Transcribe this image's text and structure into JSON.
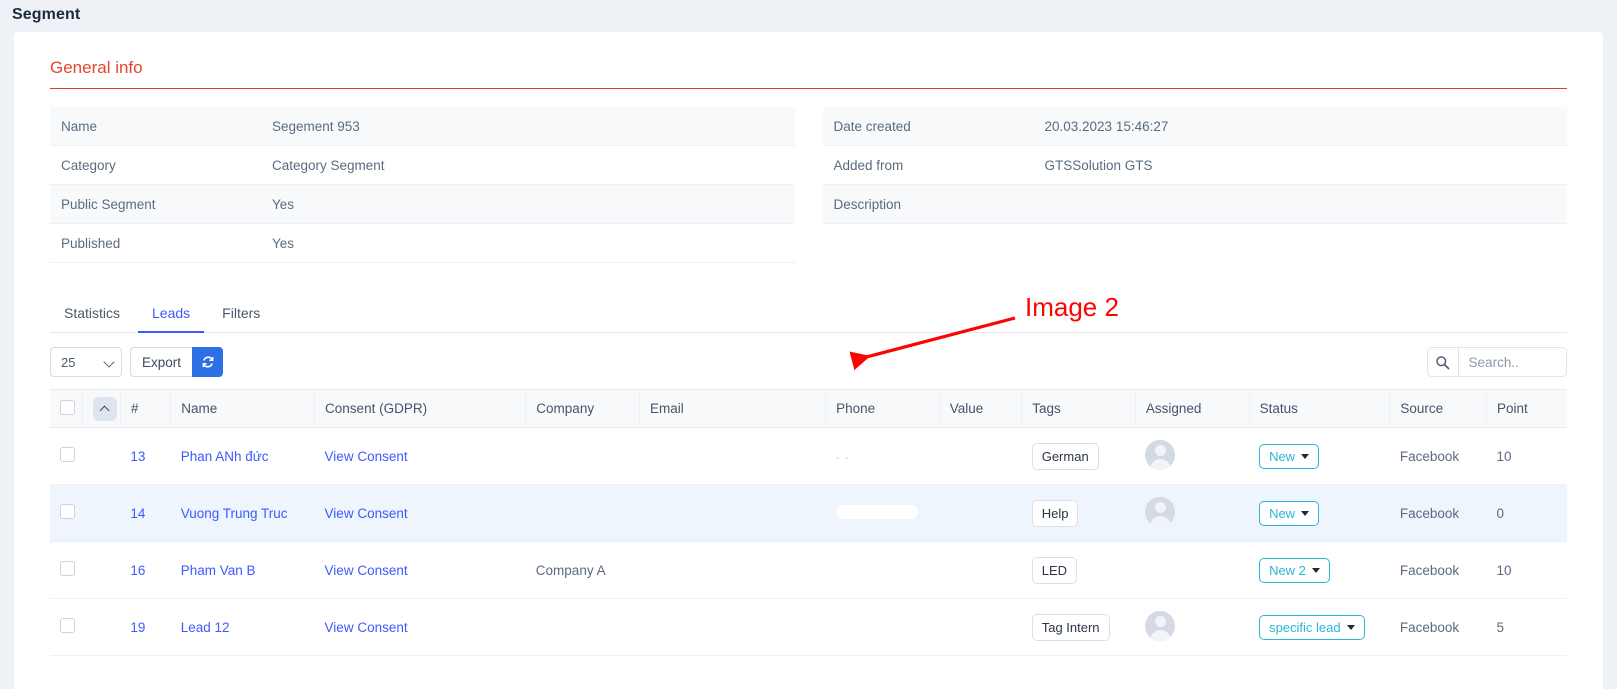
{
  "page": {
    "title": "Segment"
  },
  "general_info": {
    "heading": "General info",
    "left_rows": [
      {
        "label": "Name",
        "value": "Segement 953"
      },
      {
        "label": "Category",
        "value": "Category Segment"
      },
      {
        "label": "Public Segment",
        "value": "Yes"
      },
      {
        "label": "Published",
        "value": "Yes"
      }
    ],
    "right_rows": [
      {
        "label": "Date created",
        "value": "20.03.2023 15:46:27"
      },
      {
        "label": "Added from",
        "value": "GTSSolution GTS"
      },
      {
        "label": "Description",
        "value": ""
      }
    ]
  },
  "tabs": [
    {
      "label": "Statistics",
      "active": false
    },
    {
      "label": "Leads",
      "active": true
    },
    {
      "label": "Filters",
      "active": false
    }
  ],
  "toolbar": {
    "page_size": "25",
    "page_size_options": [
      "25"
    ],
    "export_label": "Export",
    "refresh_icon": "refresh-icon",
    "search_icon": "search-icon",
    "search_value": "",
    "search_placeholder": "Search.."
  },
  "table": {
    "columns": [
      "",
      "",
      "#",
      "Name",
      "Consent (GDPR)",
      "Company",
      "Email",
      "Phone",
      "Value",
      "Tags",
      "Assigned",
      "Status",
      "Source",
      "Point"
    ],
    "rows": [
      {
        "id": "13",
        "name": "Phan ANh đức",
        "consent": "View Consent",
        "company": "",
        "email": "",
        "phone": "- -",
        "value": "",
        "tag": "German",
        "assigned": "avatar-placeholder",
        "status": "New",
        "source": "Facebook",
        "point": "10",
        "striped": false
      },
      {
        "id": "14",
        "name": "Vuong Trung Truc",
        "consent": "View Consent",
        "company": "",
        "email": "",
        "phone": "",
        "value": "",
        "tag": "Help",
        "assigned": "avatar-placeholder",
        "status": "New",
        "source": "Facebook",
        "point": "0",
        "striped": true
      },
      {
        "id": "16",
        "name": "Pham Van B",
        "consent": "View Consent",
        "company": "Company A",
        "email": "",
        "phone": "",
        "value": "",
        "tag": "LED",
        "assigned": "",
        "status": "New 2",
        "source": "Facebook",
        "point": "10",
        "striped": false
      },
      {
        "id": "19",
        "name": "Lead 12",
        "consent": "View Consent",
        "company": "",
        "email": "",
        "phone": "",
        "value": "",
        "tag": "Tag Intern",
        "assigned": "avatar-placeholder",
        "status": "specific lead",
        "source": "Facebook",
        "point": "5",
        "striped": false
      }
    ]
  },
  "annotation": {
    "label": "Image 2",
    "color": "#fb0500"
  },
  "colors": {
    "accent_red": "#e8452c",
    "link_blue": "#3d5afe",
    "primary_blue": "#2f6fe4",
    "status_cyan": "#29b6d8",
    "page_bg": "#eef1f6"
  }
}
